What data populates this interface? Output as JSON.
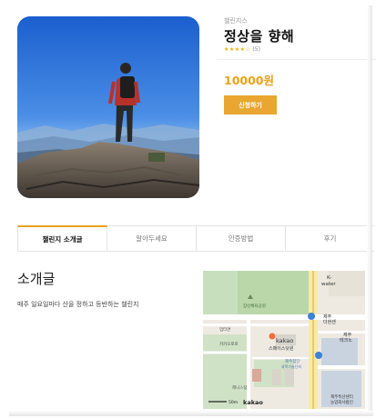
{
  "product": {
    "category": "챌린지스",
    "title": "정상을 향해",
    "rating_stars": "★★★★☆",
    "rating_count": "(5)",
    "rating_value": 4,
    "rating_max": 5,
    "price": "10000원",
    "apply_button": "신청하기"
  },
  "tabs": [
    {
      "label": "챌린지 소개글",
      "active": true
    },
    {
      "label": "알아두세요",
      "active": false
    },
    {
      "label": "인증방법",
      "active": false
    },
    {
      "label": "후기",
      "active": false
    }
  ],
  "intro": {
    "heading": "소개글",
    "text": "매주 일요일마다 산을 정하고 등반하는 챌린지"
  },
  "map": {
    "labels": {
      "kwater": "K-\nwater",
      "park": "장산체육공원",
      "office": "업터면",
      "kakao_corp": "kakao",
      "kakao_space": "스페이스닷원",
      "jeju_pension": "제주\n더현센",
      "jeju_tax": "제주\n테크노",
      "jeju_card": "제주첨단\n과학기술단지",
      "health": "헤니스팀",
      "jeju_center": "제주특산센터\n농업회사법인",
      "kakao_road": "카카오로",
      "scale": "50m",
      "logo": "kakao"
    }
  },
  "colors": {
    "accent": "#e9a21a",
    "button": "#e9a630"
  }
}
